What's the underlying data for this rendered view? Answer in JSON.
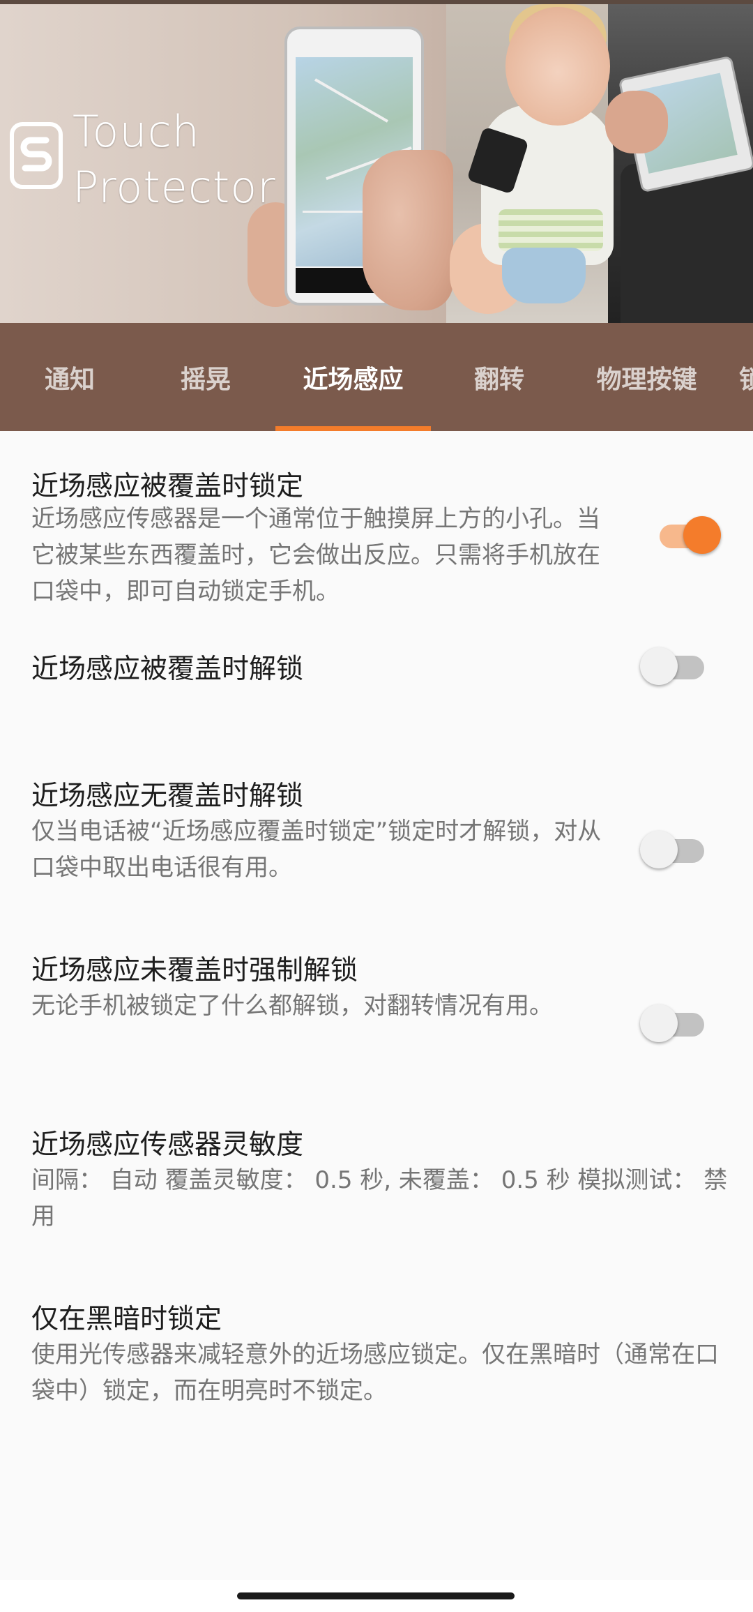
{
  "banner": {
    "logo_line1": "Touch",
    "logo_line2": "Protector"
  },
  "tabs": [
    {
      "label": "通知",
      "active": false
    },
    {
      "label": "摇晃",
      "active": false
    },
    {
      "label": "近场感应",
      "active": true
    },
    {
      "label": "翻转",
      "active": false
    },
    {
      "label": "物理按键",
      "active": false
    },
    {
      "label": "锁",
      "active": false
    }
  ],
  "settings": [
    {
      "title": "近场感应被覆盖时锁定",
      "summary": "近场感应传感器是一个通常位于触摸屏上方的小孔。当它被某些东西覆盖时，它会做出反应。只需将手机放在口袋中，即可自动锁定手机。",
      "toggle": true
    },
    {
      "title": "近场感应被覆盖时解锁",
      "summary": "",
      "toggle": false
    },
    {
      "title": "近场感应无覆盖时解锁",
      "summary": "仅当电话被“近场感应覆盖时锁定”锁定时才解锁，对从口袋中取出电话很有用。",
      "toggle": false
    },
    {
      "title": "近场感应未覆盖时强制解锁",
      "summary": "无论手机被锁定了什么都解锁，对翻转情况有用。",
      "toggle": false
    },
    {
      "title": "近场感应传感器灵敏度",
      "summary": "间隔： 自动 覆盖灵敏度： 0.5 秒, 未覆盖： 0.5 秒 模拟测试： 禁用"
    },
    {
      "title": "仅在黑暗时锁定",
      "summary": "使用光传感器来减轻意外的近场感应锁定。仅在黑暗时（通常在口袋中）锁定，而在明亮时不锁定。"
    }
  ],
  "colors": {
    "tabbar_bg": "#7b5a4c",
    "accent": "#f47c2b",
    "page_bg": "#fafafa"
  }
}
